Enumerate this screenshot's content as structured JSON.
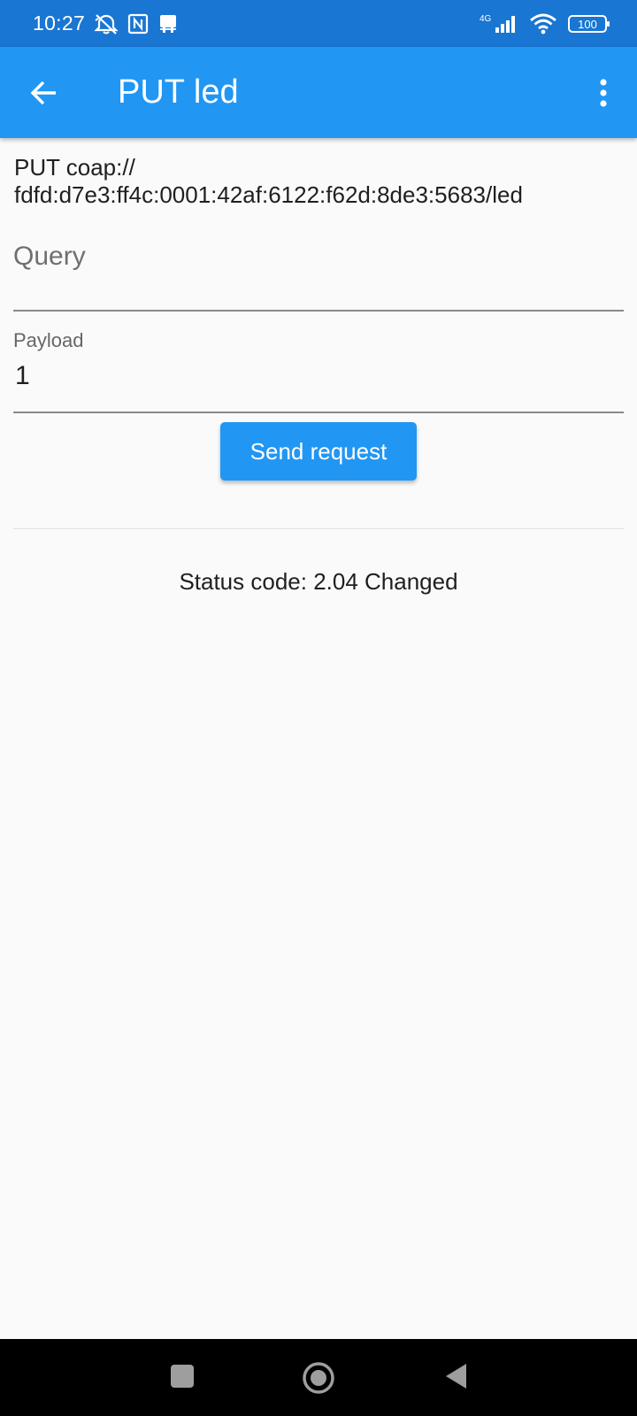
{
  "status_bar": {
    "time": "10:27",
    "network_label": "4G",
    "battery_level": "100",
    "icons": [
      "alarm-off-icon",
      "nfc-icon",
      "notification-icon",
      "signal-icon",
      "wifi-icon",
      "battery-icon"
    ]
  },
  "app_bar": {
    "title": "PUT led",
    "back_icon": "arrow-back-icon",
    "menu_icon": "more-vert-icon"
  },
  "request": {
    "uri": "PUT coap://\nfdfd:d7e3:ff4c:0001:42af:6122:f62d:8de3:5683/led"
  },
  "query_field": {
    "placeholder": "Query",
    "value": ""
  },
  "payload_field": {
    "label": "Payload",
    "value": "1"
  },
  "send_button": {
    "label": "Send request"
  },
  "response": {
    "status_text": "Status code: 2.04 Changed"
  },
  "navigation_bar": {
    "icons": [
      "recents-square-icon",
      "home-circle-icon",
      "back-triangle-icon"
    ]
  },
  "colors": {
    "status_bar": "#1976d2",
    "app_bar": "#2196f3",
    "button": "#2196f3",
    "background": "#fafafa"
  }
}
